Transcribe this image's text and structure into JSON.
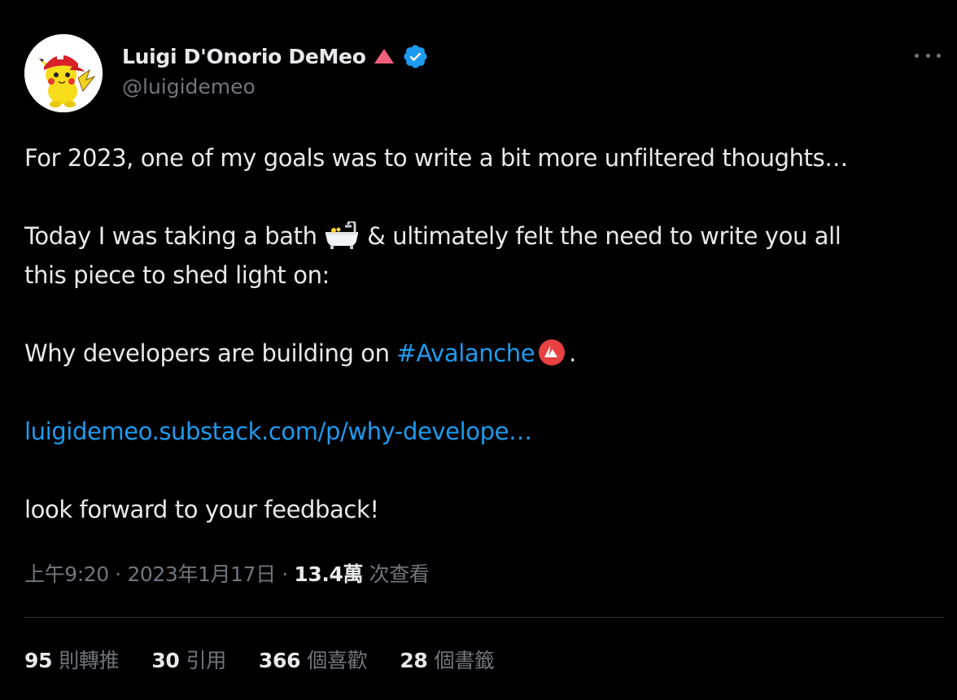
{
  "author": {
    "display_name": "Luigi D'Onorio DeMeo",
    "handle": "@luigidemeo",
    "name_emoji": "red-triangle-icon",
    "verified": "verified-badge-icon",
    "avatar": "pikachu-avatar"
  },
  "tweet": {
    "line1": "For 2023, one of my goals was to write a bit more unfiltered thoughts…",
    "line2_part1": "Today I was taking a bath ",
    "line2_emoji": "bathtub-icon",
    "line2_part2": " & ultimately felt the need to write you all",
    "line3": "this piece to shed light on:",
    "line4_part1": "Why developers are building on ",
    "hashtag": "#Avalanche",
    "line4_emoji": "avalanche-logo-icon",
    "line4_end": ".",
    "link": "luigidemeo.substack.com/p/why-develope…",
    "line5": "look forward to your feedback!"
  },
  "meta": {
    "time": "上午9:20",
    "sep1": " · ",
    "date": "2023年1月17日",
    "sep2": " · ",
    "views_count": "13.4萬",
    "views_label": " 次查看"
  },
  "stats": [
    {
      "count": "95",
      "label": "則轉推"
    },
    {
      "count": "30",
      "label": "引用"
    },
    {
      "count": "366",
      "label": "個喜歡"
    },
    {
      "count": "28",
      "label": "個書籤"
    }
  ],
  "colors": {
    "background": "#000000",
    "text": "#e7e9ea",
    "secondary": "#71767b",
    "accent": "#1d9bf0",
    "divider": "#2f3336"
  }
}
